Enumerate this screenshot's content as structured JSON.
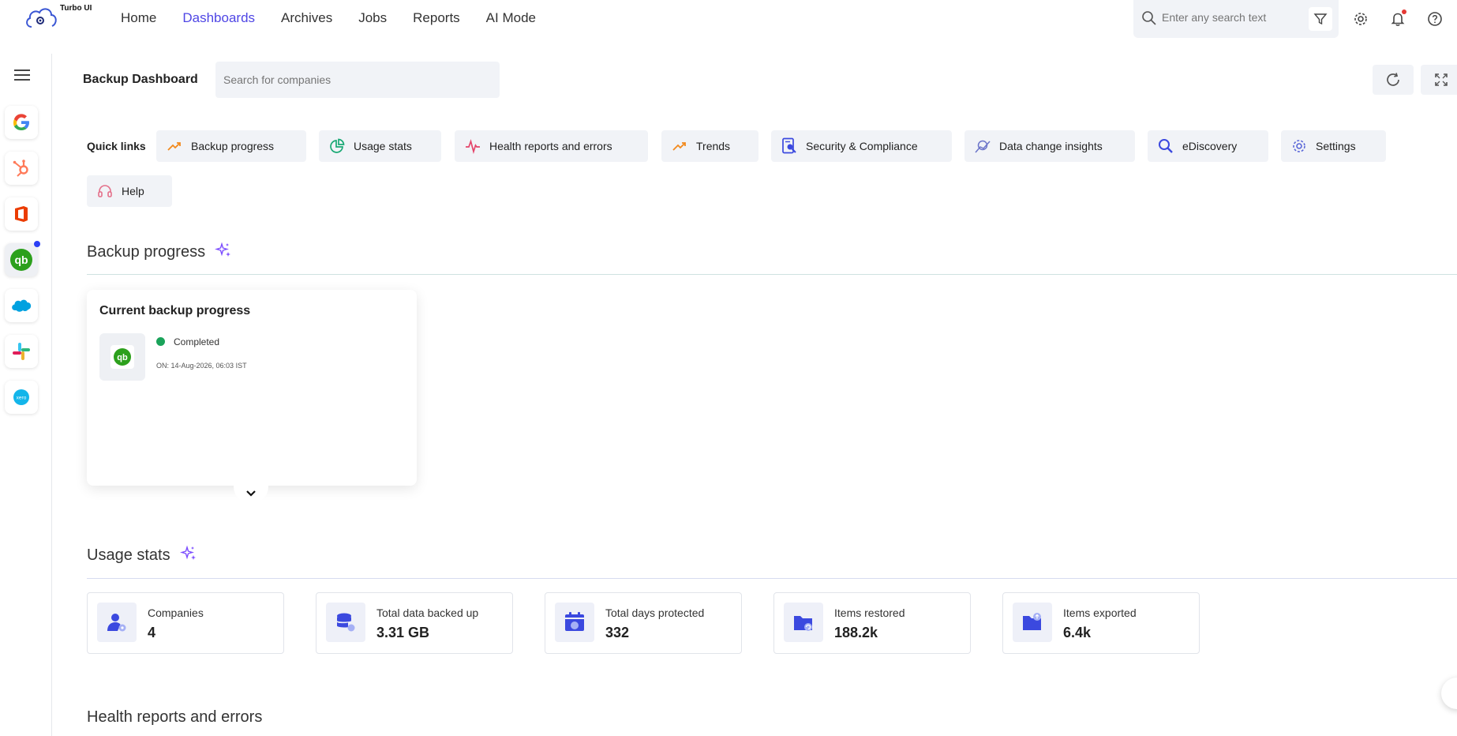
{
  "app": {
    "logo_text": "Turbo UI"
  },
  "nav": {
    "items": [
      "Home",
      "Dashboards",
      "Archives",
      "Jobs",
      "Reports",
      "AI Mode"
    ],
    "active": "Dashboards"
  },
  "top_search": {
    "placeholder": "Enter any search text"
  },
  "header": {
    "title": "Backup Dashboard",
    "company_search_placeholder": "Search for companies"
  },
  "quick_links": {
    "label": "Quick links",
    "items": [
      {
        "label": "Backup progress",
        "icon": "trend-up-icon"
      },
      {
        "label": "Usage stats",
        "icon": "pie-chart-icon"
      },
      {
        "label": "Health reports and errors",
        "icon": "pulse-icon"
      },
      {
        "label": "Trends",
        "icon": "trend-up-icon"
      },
      {
        "label": "Security & Compliance",
        "icon": "security-doc-icon"
      },
      {
        "label": "Data change insights",
        "icon": "insights-icon"
      },
      {
        "label": "eDiscovery",
        "icon": "search-icon"
      },
      {
        "label": "Settings",
        "icon": "gear-icon"
      },
      {
        "label": "Help",
        "icon": "headset-icon"
      }
    ]
  },
  "backup_progress": {
    "title": "Backup progress",
    "card_title": "Current backup progress",
    "status": "Completed",
    "on_text": "ON: 14-Aug-2026, 06:03 IST"
  },
  "usage_stats": {
    "title": "Usage stats",
    "items": [
      {
        "label": "Companies",
        "value": "4",
        "icon": "user-gear-icon"
      },
      {
        "label": "Total data backed up",
        "value": "3.31 GB",
        "icon": "database-icon"
      },
      {
        "label": "Total days protected",
        "value": "332",
        "icon": "calendar-shield-icon"
      },
      {
        "label": "Items restored",
        "value": "188.2k",
        "icon": "folder-restore-icon"
      },
      {
        "label": "Items exported",
        "value": "6.4k",
        "icon": "folder-export-icon"
      }
    ]
  },
  "health": {
    "title": "Health reports and errors"
  },
  "sidebar_apps": [
    "google",
    "hubspot",
    "office",
    "quickbooks",
    "salesforce",
    "slack",
    "xero"
  ],
  "colors": {
    "accent": "#4f46e5",
    "success": "#1aa35a",
    "qb_green": "#2ca01c"
  }
}
